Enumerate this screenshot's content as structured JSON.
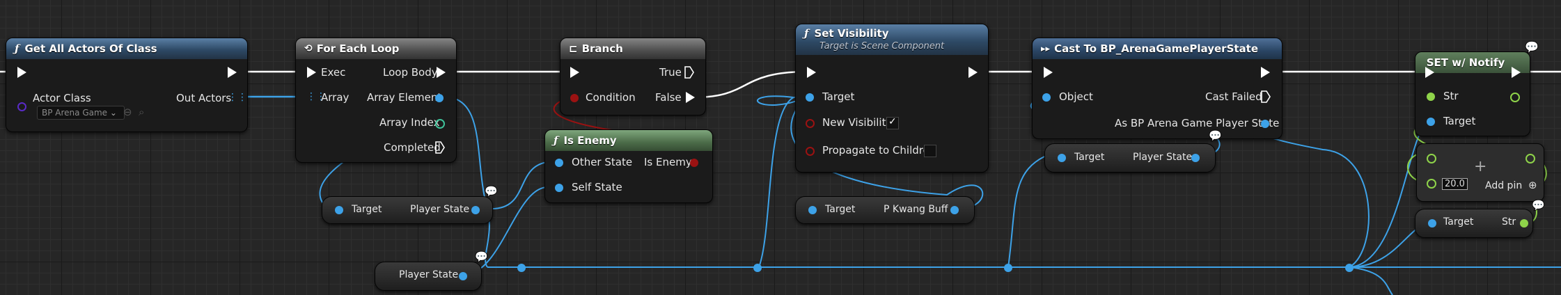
{
  "nodes": {
    "get_all_actors": {
      "title": "Get All Actors Of Class",
      "actor_class_label": "Actor Class",
      "actor_class_value": "BP Arena Game",
      "out_actors_label": "Out Actors"
    },
    "for_each_loop": {
      "title": "For Each Loop",
      "exec_label": "Exec",
      "array_label": "Array",
      "loop_body_label": "Loop Body",
      "array_element_label": "Array Element",
      "array_index_label": "Array Index",
      "completed_label": "Completed"
    },
    "branch": {
      "title": "Branch",
      "condition_label": "Condition",
      "true_label": "True",
      "false_label": "False"
    },
    "is_enemy": {
      "title": "Is Enemy",
      "other_state_label": "Other State",
      "self_state_label": "Self State",
      "is_enemy_label": "Is Enemy"
    },
    "set_visibility": {
      "title": "Set Visibility",
      "subtitle": "Target is Scene Component",
      "target_label": "Target",
      "new_visibility_label": "New Visibility",
      "propagate_label": "Propagate to Children",
      "new_visibility_checked": true,
      "propagate_checked": false
    },
    "cast": {
      "title": "Cast To BP_ArenaGamePlayerState",
      "object_label": "Object",
      "cast_failed_label": "Cast Failed",
      "as_label": "As BP Arena Game Player State"
    },
    "set_notify": {
      "title": "SET w/ Notify",
      "str_label": "Str",
      "target_label": "Target"
    },
    "add_node": {
      "value": "20.0",
      "add_pin_label": "Add pin"
    }
  },
  "getters": {
    "player_state_1": {
      "target_label": "Target",
      "output_label": "Player State"
    },
    "player_state_2": {
      "output_label": "Player State"
    },
    "player_state_3": {
      "target_label": "Target",
      "output_label": "Player State"
    },
    "p_kwang_buff": {
      "target_label": "Target",
      "output_label": "P Kwang Buff"
    },
    "str_getter": {
      "target_label": "Target",
      "output_label": "Str"
    }
  },
  "colors": {
    "exec": "#ffffff",
    "object_pin": "#3da2e8",
    "bool_pin": "#9b1212",
    "float_pin": "#8fd44a",
    "int_pin": "#3fc29a",
    "class_pin": "#5a2bc7"
  },
  "icons": [
    "function-icon",
    "loop-icon",
    "branch-icon",
    "cast-icon",
    "grid-array-icon",
    "dropdown-icon",
    "browse-icon",
    "search-icon",
    "checkbox-check-icon",
    "add-pin-icon"
  ]
}
